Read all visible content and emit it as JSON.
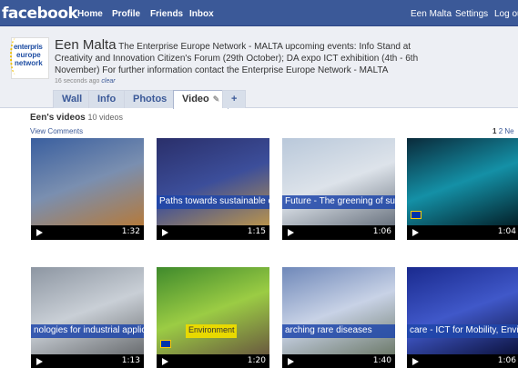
{
  "topbar": {
    "logo": "facebook",
    "nav": [
      "Home",
      "Profile",
      "Friends",
      "Inbox"
    ],
    "user": "Een Malta",
    "settings": "Settings",
    "logout": "Log out"
  },
  "profile": {
    "logo_lines": [
      "enterpris",
      "europe",
      "network"
    ],
    "name": "Een Malta",
    "status_text": "The Enterprise Europe Network - MALTA upcoming events: Info Stand at Creativity and Innovation Citizen's Forum (29th October); DA expo ICT exhibition (4th - 6th November) For further information contact the Enterprise Europe Network - MALTA",
    "time": "16 seconds ago",
    "clear": "clear",
    "tabs": [
      "Wall",
      "Info",
      "Photos",
      "Video",
      "+"
    ],
    "active_tab": "Video"
  },
  "videos_section": {
    "title": "Een's videos",
    "count": "10 videos",
    "view_comments": "View Comments",
    "pages": [
      "1",
      "2",
      "Ne"
    ]
  },
  "videos": [
    {
      "caption": "",
      "duration": "1:32",
      "colors": [
        "#3a5f9f",
        "#7a8fb0",
        "#b47a3c"
      ]
    },
    {
      "caption": "Paths towards sustainable c",
      "duration": "1:15",
      "colors": [
        "#2a2f6a",
        "#3c4e9a",
        "#b8934d"
      ]
    },
    {
      "caption": "Future - The greening of sur",
      "duration": "1:06",
      "colors": [
        "#b9c8da",
        "#dde3ea",
        "#6b7480"
      ]
    },
    {
      "caption": "",
      "duration": "1:04",
      "colors": [
        "#0a2a3a",
        "#1490a6",
        "#032029"
      ]
    },
    {
      "caption": "nologies for industrial applic",
      "duration": "1:13",
      "colors": [
        "#8d96a2",
        "#c9cfd6",
        "#6a6d70"
      ]
    },
    {
      "caption": "Environment",
      "duration": "1:20",
      "colors": [
        "#3f8a2c",
        "#9bcc44",
        "#6a5a3f"
      ]
    },
    {
      "caption": "arching rare diseases",
      "duration": "1:40",
      "colors": [
        "#6f88b9",
        "#c8d2e6",
        "#6e7b6b"
      ]
    },
    {
      "caption": "care - ICT for Mobility, Envir",
      "duration": "1:06",
      "colors": [
        "#1a2a8e",
        "#4058c9",
        "#0c123d"
      ]
    }
  ]
}
